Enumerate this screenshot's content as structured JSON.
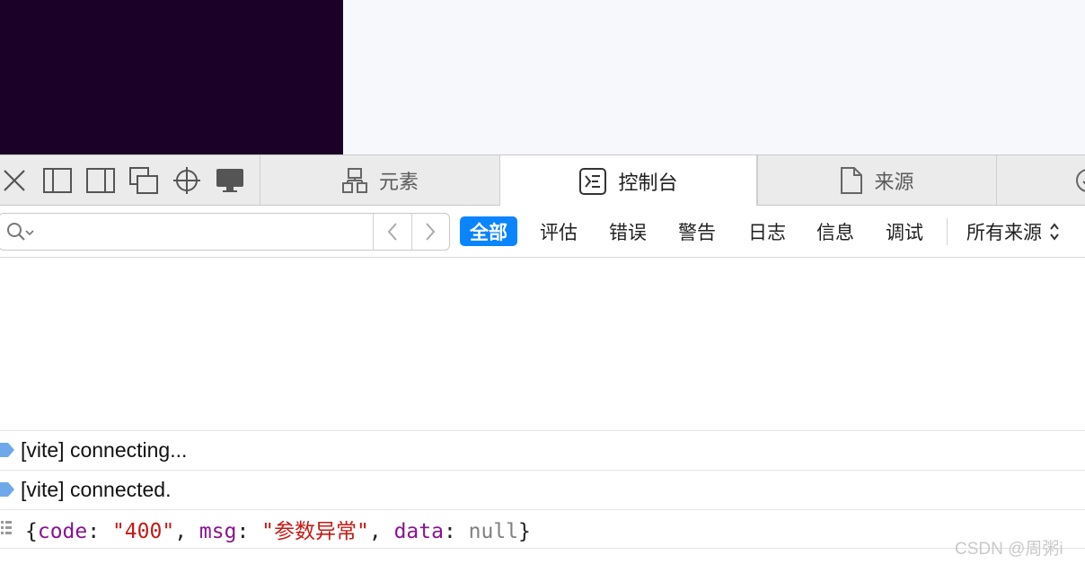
{
  "tabs": [
    {
      "label": "元素",
      "icon": "elements-icon",
      "active": false
    },
    {
      "label": "控制台",
      "icon": "console-icon",
      "active": true
    },
    {
      "label": "来源",
      "icon": "document-icon",
      "active": false
    }
  ],
  "toolbar_icons": [
    "close-icon",
    "dock-left-icon",
    "dock-right-icon",
    "undock-icon",
    "inspect-crosshair-icon",
    "device-monitor-icon"
  ],
  "filter": {
    "search_placeholder": "",
    "levels": [
      "全部",
      "评估",
      "错误",
      "警告",
      "日志",
      "信息",
      "调试"
    ],
    "active_level": "全部",
    "source_select": "所有来源"
  },
  "console": {
    "logs": [
      {
        "type": "info",
        "text": "[vite] connecting..."
      },
      {
        "type": "info",
        "text": "[vite] connected."
      }
    ],
    "object_log": {
      "open": "{",
      "k1": "code",
      "v1": "\"400\"",
      "k2": "msg",
      "v2": "\"参数异常\"",
      "k3": "data",
      "v3": "null",
      "close": "}"
    }
  },
  "watermark": "CSDN @周粥i",
  "colors": {
    "accent": "#0a84ff",
    "page_dark": "#1b0128",
    "info_dot": "#6fa8ea"
  }
}
